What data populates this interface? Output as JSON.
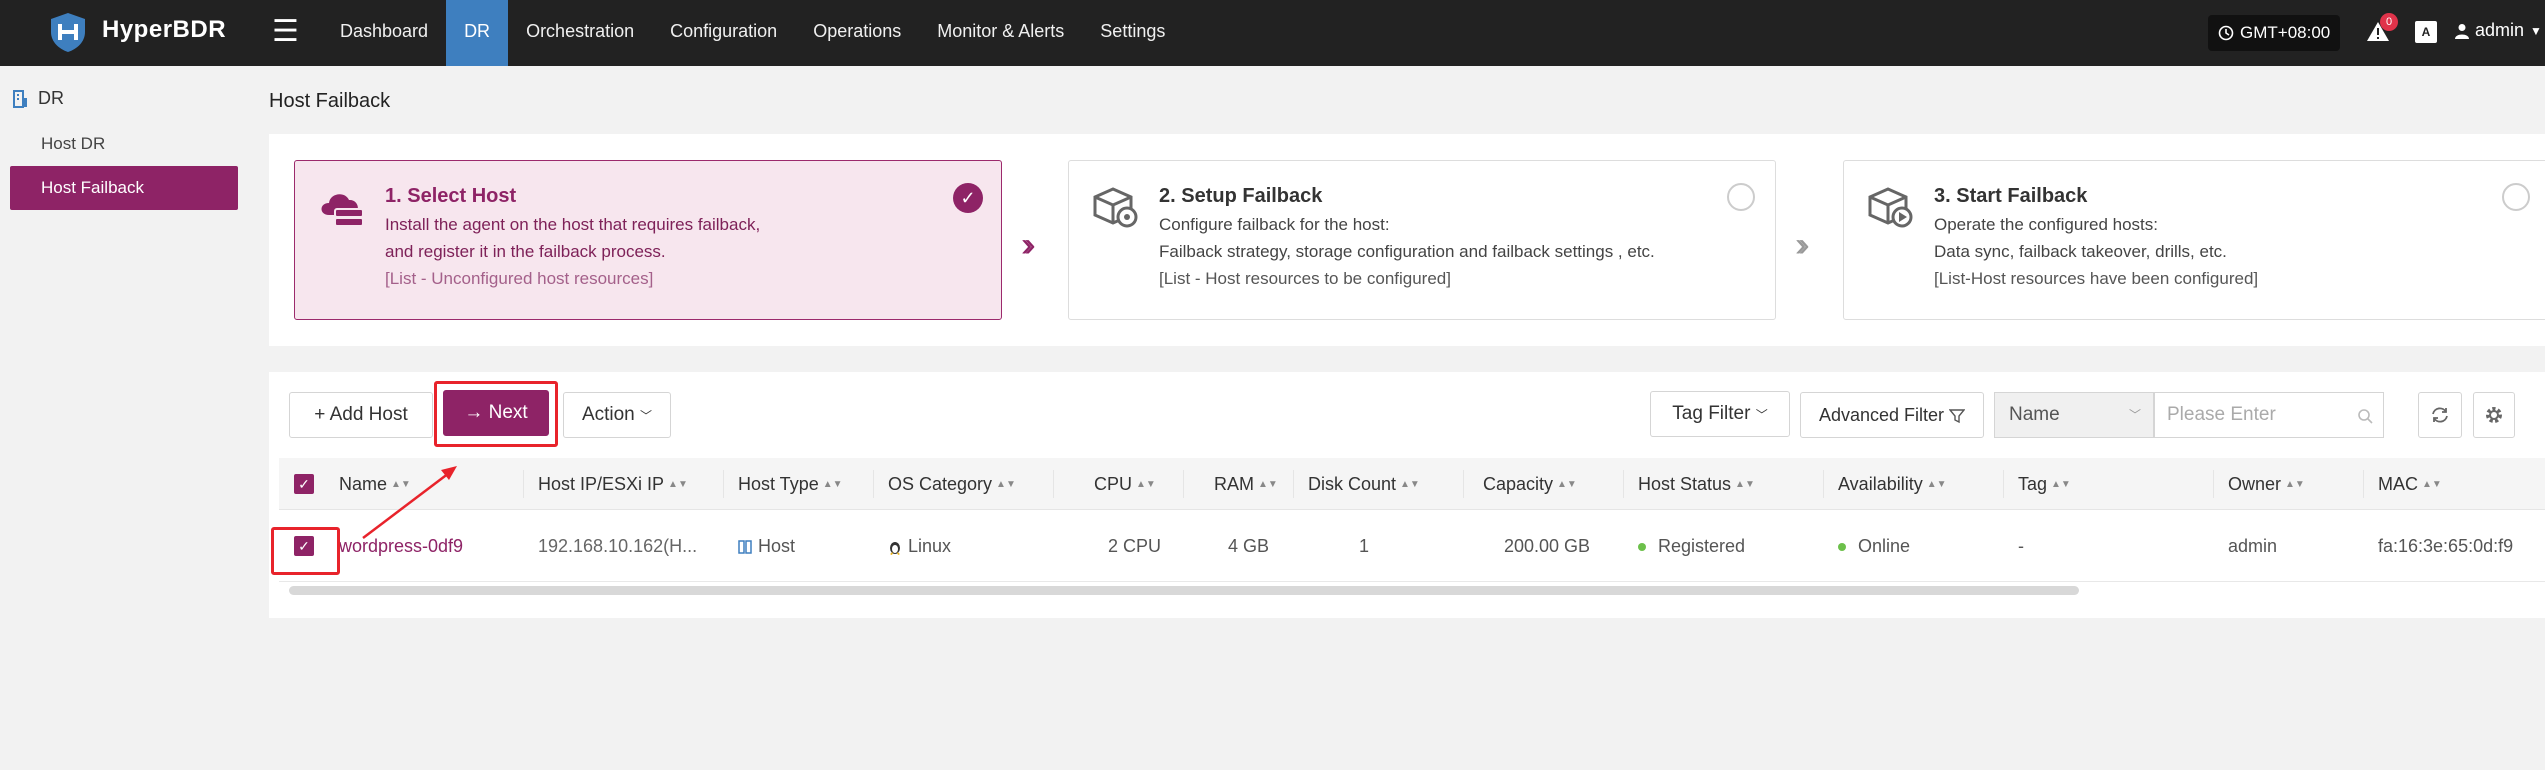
{
  "app": {
    "brand": "HyperBDR"
  },
  "nav": [
    {
      "label": "Dashboard",
      "active": false
    },
    {
      "label": "DR",
      "active": true
    },
    {
      "label": "Orchestration",
      "active": false
    },
    {
      "label": "Configuration",
      "active": false
    },
    {
      "label": "Operations",
      "active": false
    },
    {
      "label": "Monitor & Alerts",
      "active": false
    },
    {
      "label": "Settings",
      "active": false
    }
  ],
  "header": {
    "timezone": "GMT+08:00",
    "alert_count": "0",
    "user": "admin",
    "lang_icon": "A"
  },
  "sidebar": {
    "group": "DR",
    "items": [
      {
        "label": "Host DR",
        "active": false
      },
      {
        "label": "Host Failback",
        "active": true
      }
    ]
  },
  "page": {
    "title": "Host Failback"
  },
  "steps": [
    {
      "title": "1. Select Host",
      "line1": "Install the agent on the host that requires failback,",
      "line2": "and register it in the failback process.",
      "hint": "[List - Unconfigured host resources]"
    },
    {
      "title": "2. Setup Failback",
      "line1": "Configure failback for the host:",
      "line2": "Failback strategy, storage configuration and failback settings , etc.",
      "hint": "[List - Host resources to be configured]"
    },
    {
      "title": "3. Start Failback",
      "line1": "Operate the configured hosts:",
      "line2": "Data sync, failback takeover, drills, etc.",
      "hint": "[List-Host resources have been configured]"
    }
  ],
  "toolbar": {
    "add_host": "+ Add Host",
    "next": "→ Next",
    "action": "Action",
    "tag_filter": "Tag Filter",
    "advanced_filter": "Advanced Filter",
    "search_field": "Name",
    "search_placeholder": "Please Enter"
  },
  "table": {
    "columns": [
      "Name",
      "Host IP/ESXi IP",
      "Host Type",
      "OS Category",
      "CPU",
      "RAM",
      "Disk Count",
      "Capacity",
      "Host Status",
      "Availability",
      "Tag",
      "Owner",
      "MAC"
    ],
    "rows": [
      {
        "name": "wordpress-0df9",
        "ip": "192.168.10.162(H...",
        "host_type": "Host",
        "os": "Linux",
        "cpu": "2 CPU",
        "ram": "4 GB",
        "disk_count": "1",
        "capacity": "200.00 GB",
        "status": "Registered",
        "availability": "Online",
        "tag": "-",
        "owner": "admin",
        "mac": "fa:16:3e:65:0d:f9"
      }
    ]
  },
  "colors": {
    "accent": "#8e2366",
    "nav_active": "#3e7fbf",
    "highlight": "#e8232b",
    "online": "#6cc04a"
  }
}
